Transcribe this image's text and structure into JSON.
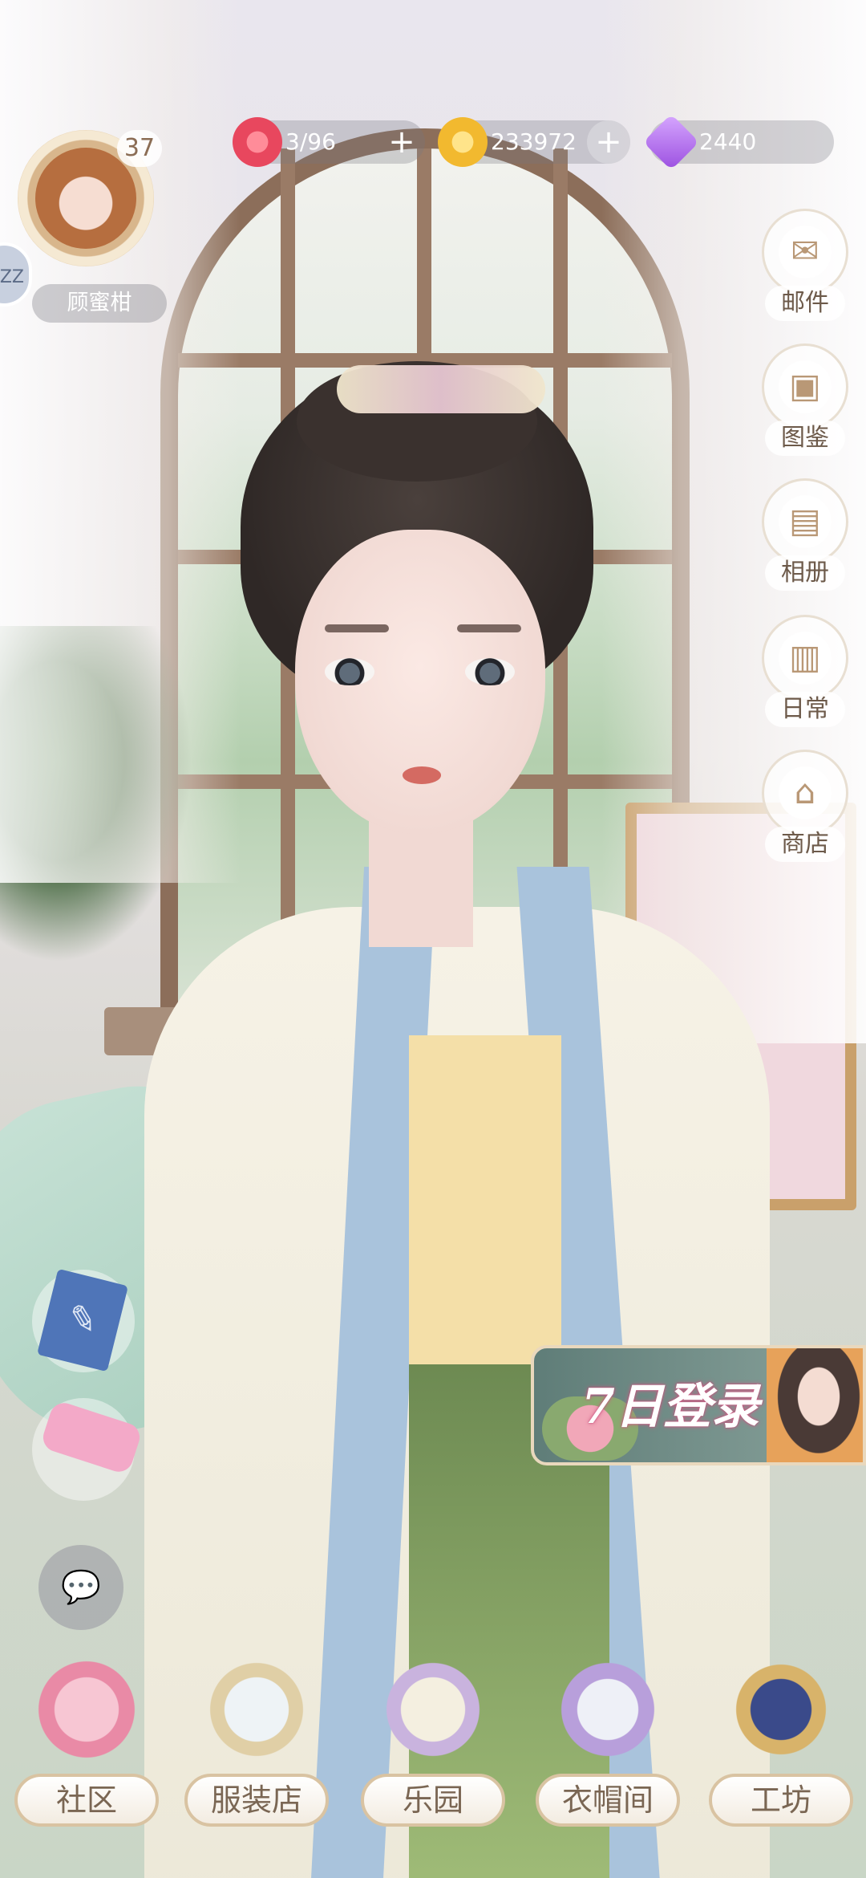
{
  "player": {
    "level": "37",
    "name": "顾蜜柑",
    "side_tab": "ZZ"
  },
  "resources": {
    "stamina": {
      "value": "3/96",
      "icon": "heart-icon",
      "color": "#e8475e"
    },
    "coins": {
      "value": "233972",
      "icon": "gold-coin-icon",
      "color": "#f2b92f"
    },
    "gems": {
      "value": "2440",
      "icon": "purple-gem-icon",
      "color": "#9b4fe0"
    },
    "plus_symbol": "+"
  },
  "right_menu": {
    "items": [
      {
        "label": "邮件",
        "icon": "envelope-icon",
        "glyph": "✉"
      },
      {
        "label": "图鉴",
        "icon": "album-book-icon",
        "glyph": "▣"
      },
      {
        "label": "相册",
        "icon": "photo-album-icon",
        "glyph": "▤"
      },
      {
        "label": "日常",
        "icon": "daily-folder-icon",
        "glyph": "▥"
      },
      {
        "label": "商店",
        "icon": "shop-icon",
        "glyph": "⌂"
      }
    ]
  },
  "left_float": {
    "notebook_icon": "notebook-icon",
    "phone_icon": "flip-phone-icon",
    "chat_icon": "chat-bubble-icon",
    "chat_glyph": "💬"
  },
  "banner": {
    "text": "7日登录"
  },
  "bottom_nav": {
    "items": [
      {
        "label": "社区",
        "icon": "roses-gift-icon",
        "color": "#f2a7bd"
      },
      {
        "label": "服装店",
        "icon": "vanity-mirror-icon",
        "color": "#e6dcc8"
      },
      {
        "label": "乐园",
        "icon": "storybook-icon",
        "color": "#d7c7e8"
      },
      {
        "label": "衣帽间",
        "icon": "wardrobe-mirror-icon",
        "color": "#c8b6e2"
      },
      {
        "label": "工坊",
        "icon": "sewing-box-icon",
        "color": "#3a4a8a"
      }
    ]
  },
  "colors": {
    "accent": "#7a6653",
    "label_bg": "#ffffff",
    "pill_bg": "#78787a"
  }
}
